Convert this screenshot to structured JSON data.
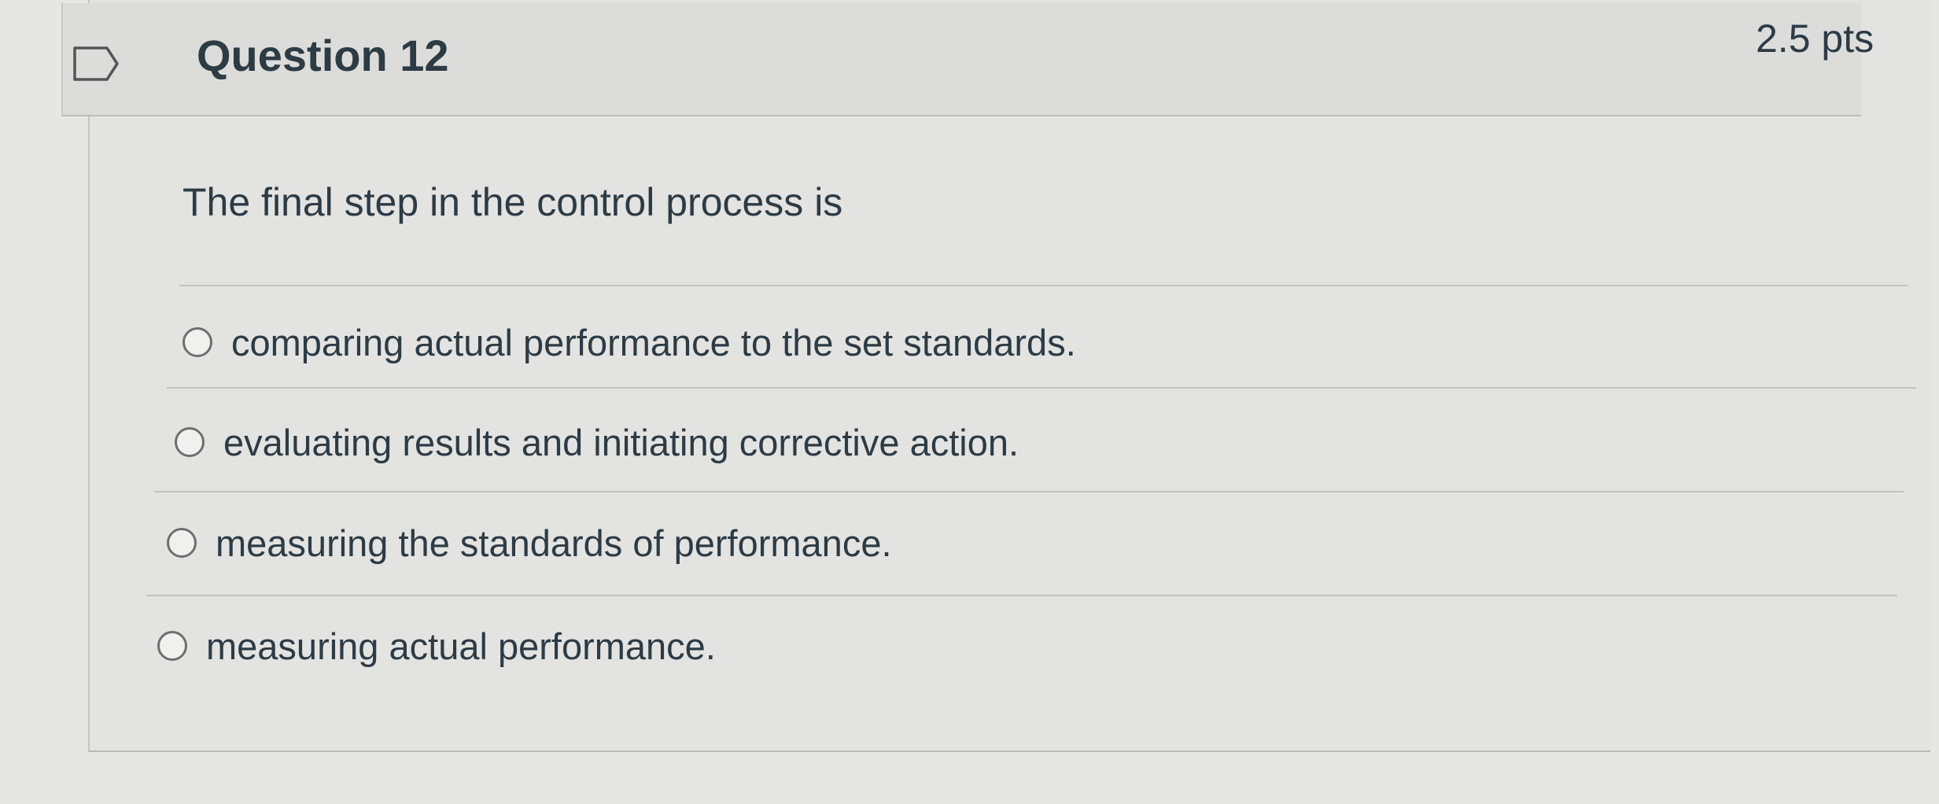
{
  "question": {
    "title": "Question 12",
    "points": "2.5 pts",
    "text": "The final step in the control process is",
    "flagged": false
  },
  "answers": [
    {
      "label": "comparing actual performance to the set standards.",
      "selected": false
    },
    {
      "label": "evaluating results and initiating corrective action.",
      "selected": false
    },
    {
      "label": "measuring the standards of performance.",
      "selected": false
    },
    {
      "label": "measuring actual performance.",
      "selected": false
    }
  ],
  "icons": {
    "flag": "bookmark-flag-icon",
    "radio": "radio-circle-icon"
  },
  "colors": {
    "text": "#2d3b45",
    "background": "#e6e6e4",
    "divider": "#c3c3c1"
  }
}
